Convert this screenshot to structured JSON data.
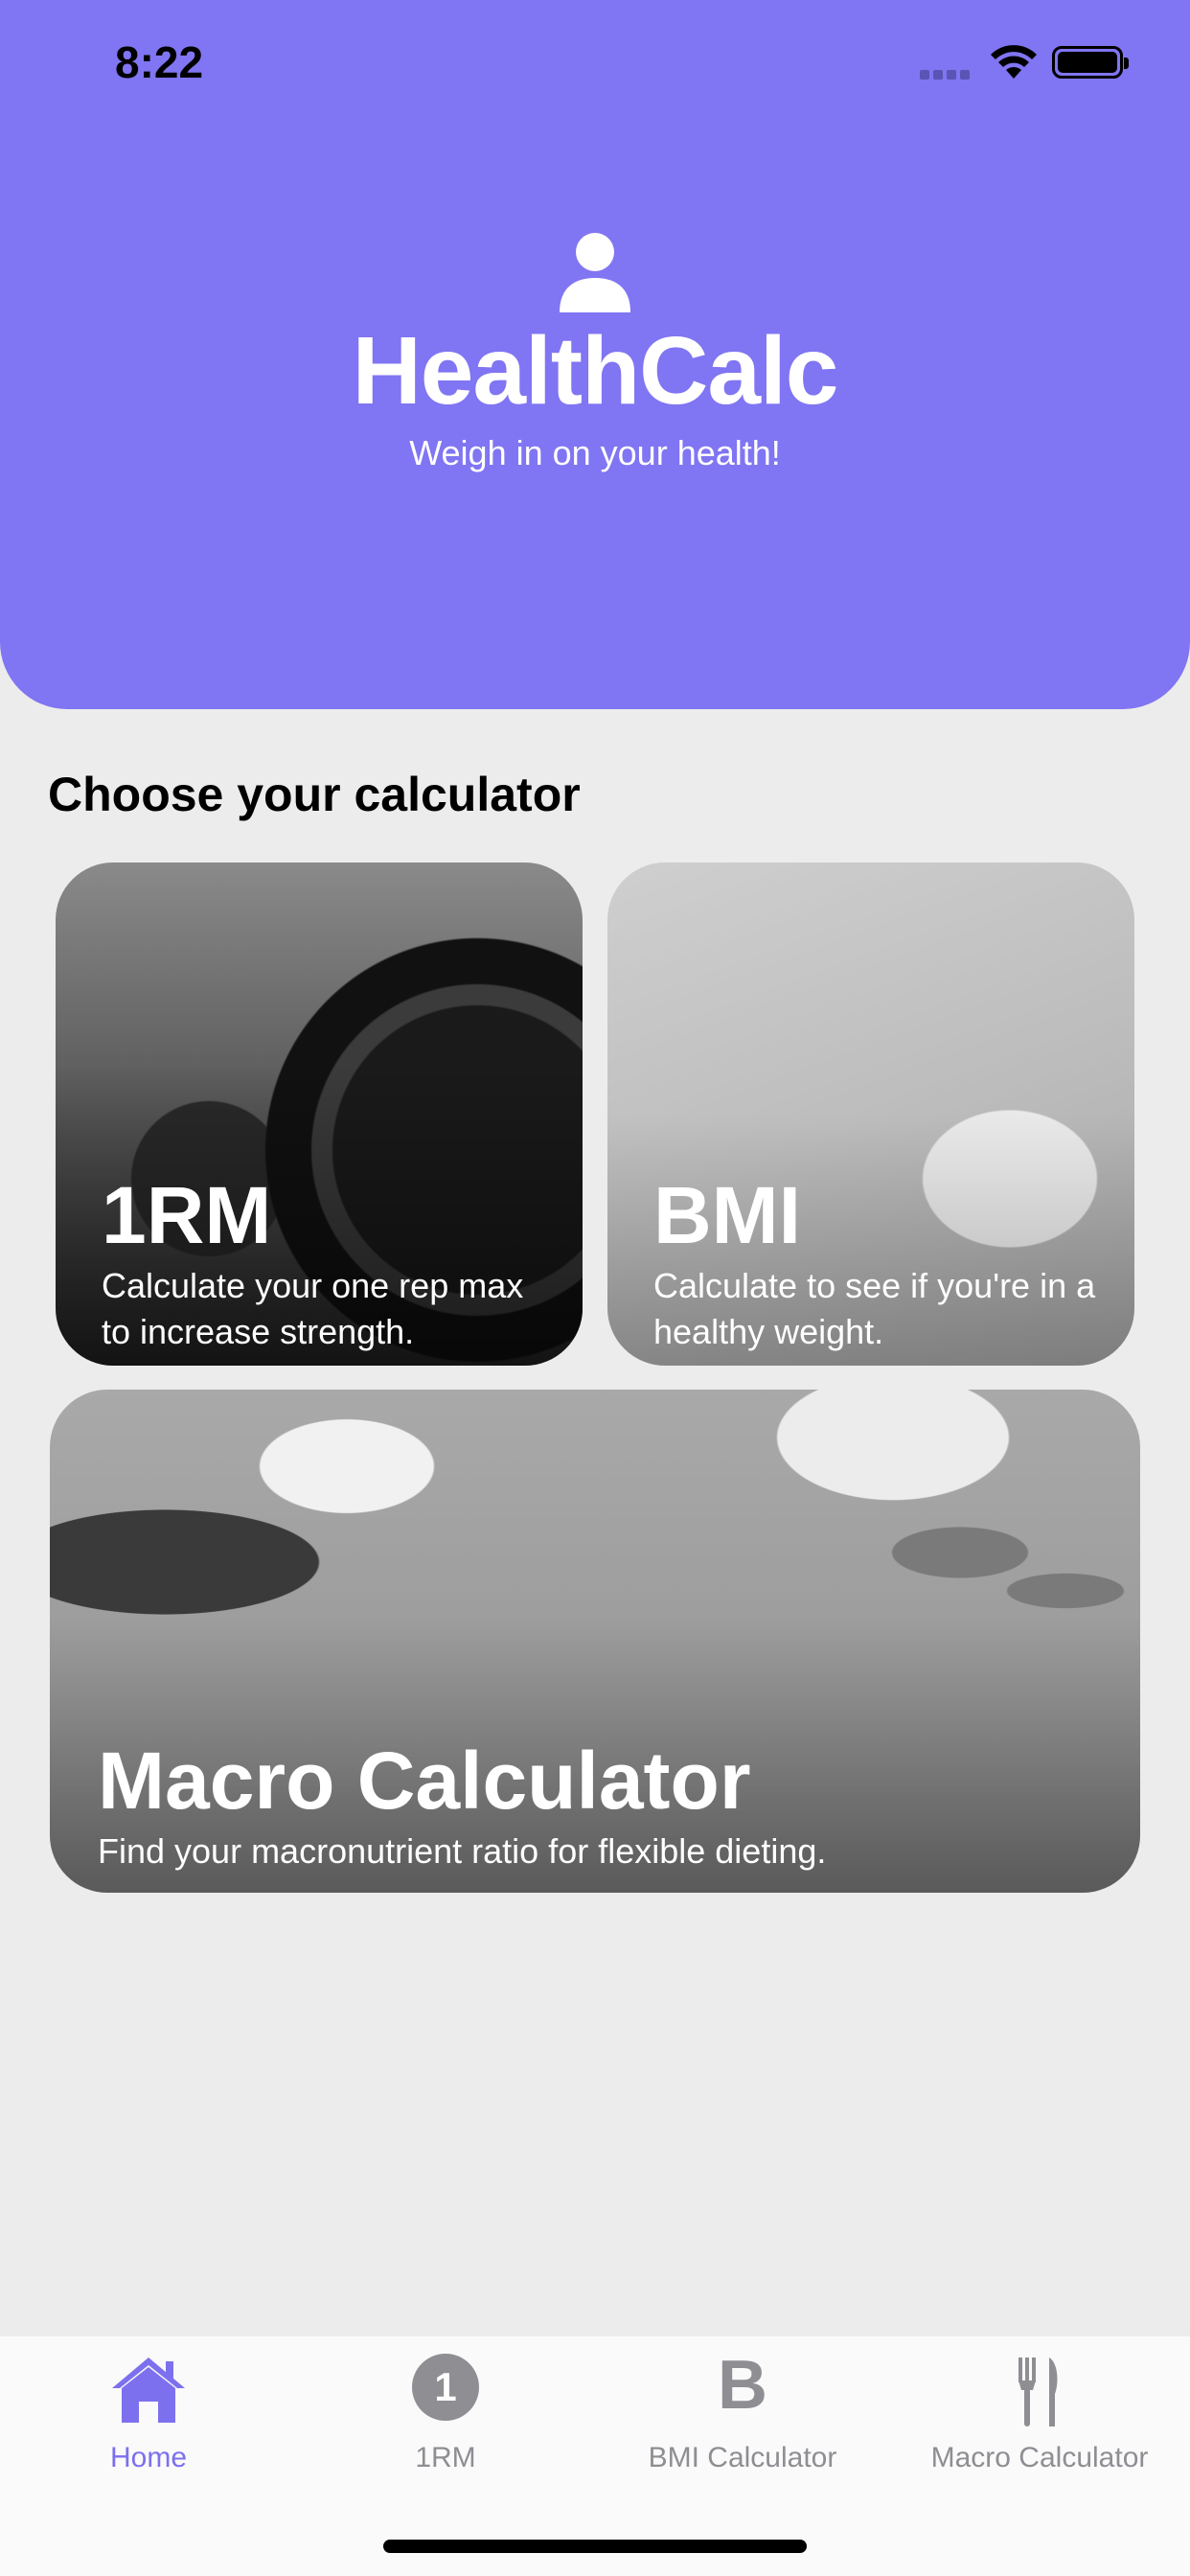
{
  "status_bar": {
    "time": "8:22"
  },
  "header": {
    "title": "HealthCalc",
    "subtitle": "Weigh in on your health!"
  },
  "section": {
    "title": "Choose your calculator"
  },
  "cards": [
    {
      "title": "1RM",
      "description": "Calculate your one rep max to increase strength."
    },
    {
      "title": "BMI",
      "description": "Calculate to see if you're in a healthy weight."
    },
    {
      "title": "Macro Calculator",
      "description": "Find your macronutrient ratio for flexible dieting."
    }
  ],
  "tabs": [
    {
      "label": "Home",
      "icon": "house-icon",
      "active": true
    },
    {
      "label": "1RM",
      "icon": "number-one-icon",
      "glyph": "1"
    },
    {
      "label": "BMI Calculator",
      "icon": "letter-b-icon",
      "glyph": "B"
    },
    {
      "label": "Macro Calculator",
      "icon": "fork-knife-icon"
    }
  ],
  "colors": {
    "accent": "#8075f2",
    "active_tab": "#7d70ee",
    "inactive_tab": "#8e8e93",
    "background": "#ececec"
  }
}
